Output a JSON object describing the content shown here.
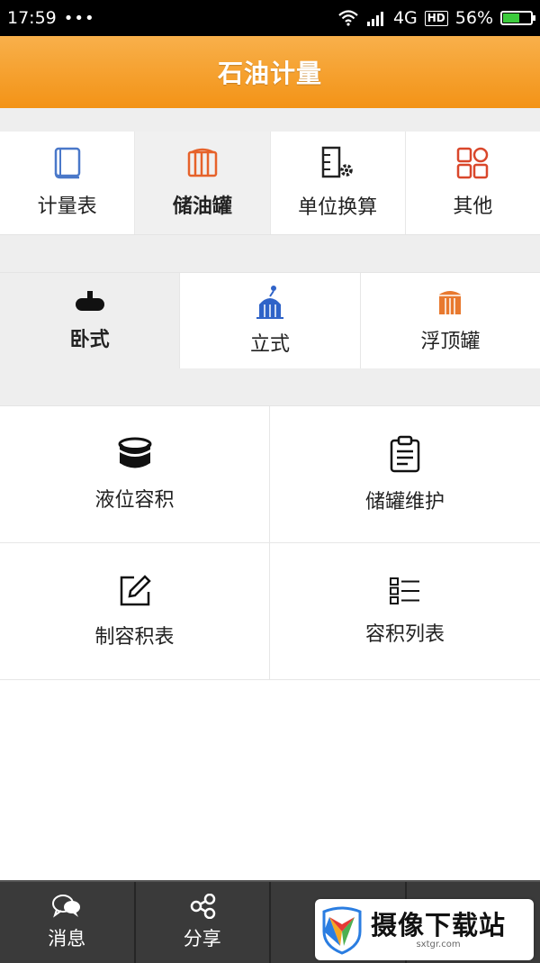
{
  "status_bar": {
    "time": "17:59",
    "dots": "•••",
    "network": "4G",
    "hd": "HD",
    "battery_text": "56%",
    "battery_level": 0.56
  },
  "header": {
    "title": "石油计量"
  },
  "categories": [
    {
      "label": "计量表",
      "icon": "book-icon",
      "active": false
    },
    {
      "label": "储油罐",
      "icon": "oil-tank-icon",
      "active": true
    },
    {
      "label": "单位换算",
      "icon": "unit-convert-icon",
      "active": false
    },
    {
      "label": "其他",
      "icon": "grid-icon",
      "active": false
    }
  ],
  "tank_types": [
    {
      "label": "卧式",
      "icon": "horizontal-tank-icon",
      "active": true
    },
    {
      "label": "立式",
      "icon": "vertical-tank-icon",
      "active": false
    },
    {
      "label": "浮顶罐",
      "icon": "floating-roof-tank-icon",
      "active": false
    }
  ],
  "functions": [
    {
      "label": "液位容积",
      "icon": "cylinder-icon"
    },
    {
      "label": "储罐维护",
      "icon": "clipboard-icon"
    },
    {
      "label": "制容积表",
      "icon": "edit-icon"
    },
    {
      "label": "容积列表",
      "icon": "list-icon"
    }
  ],
  "tabbar": [
    {
      "label": "消息",
      "icon": "chat-icon"
    },
    {
      "label": "分享",
      "icon": "share-icon"
    },
    {
      "label": "",
      "icon": "settings-icon"
    },
    {
      "label": "",
      "icon": "user-icon"
    }
  ],
  "watermark": {
    "title": "摄像下载站",
    "url": "sxtgr.com"
  },
  "colors": {
    "accent": "#f39316",
    "header_top": "#f8b04b",
    "icon_orange": "#e6622a",
    "icon_blue": "#2f63c8",
    "icon_navy": "#1f3f8a",
    "tabbar_bg": "#3a3a3a"
  }
}
